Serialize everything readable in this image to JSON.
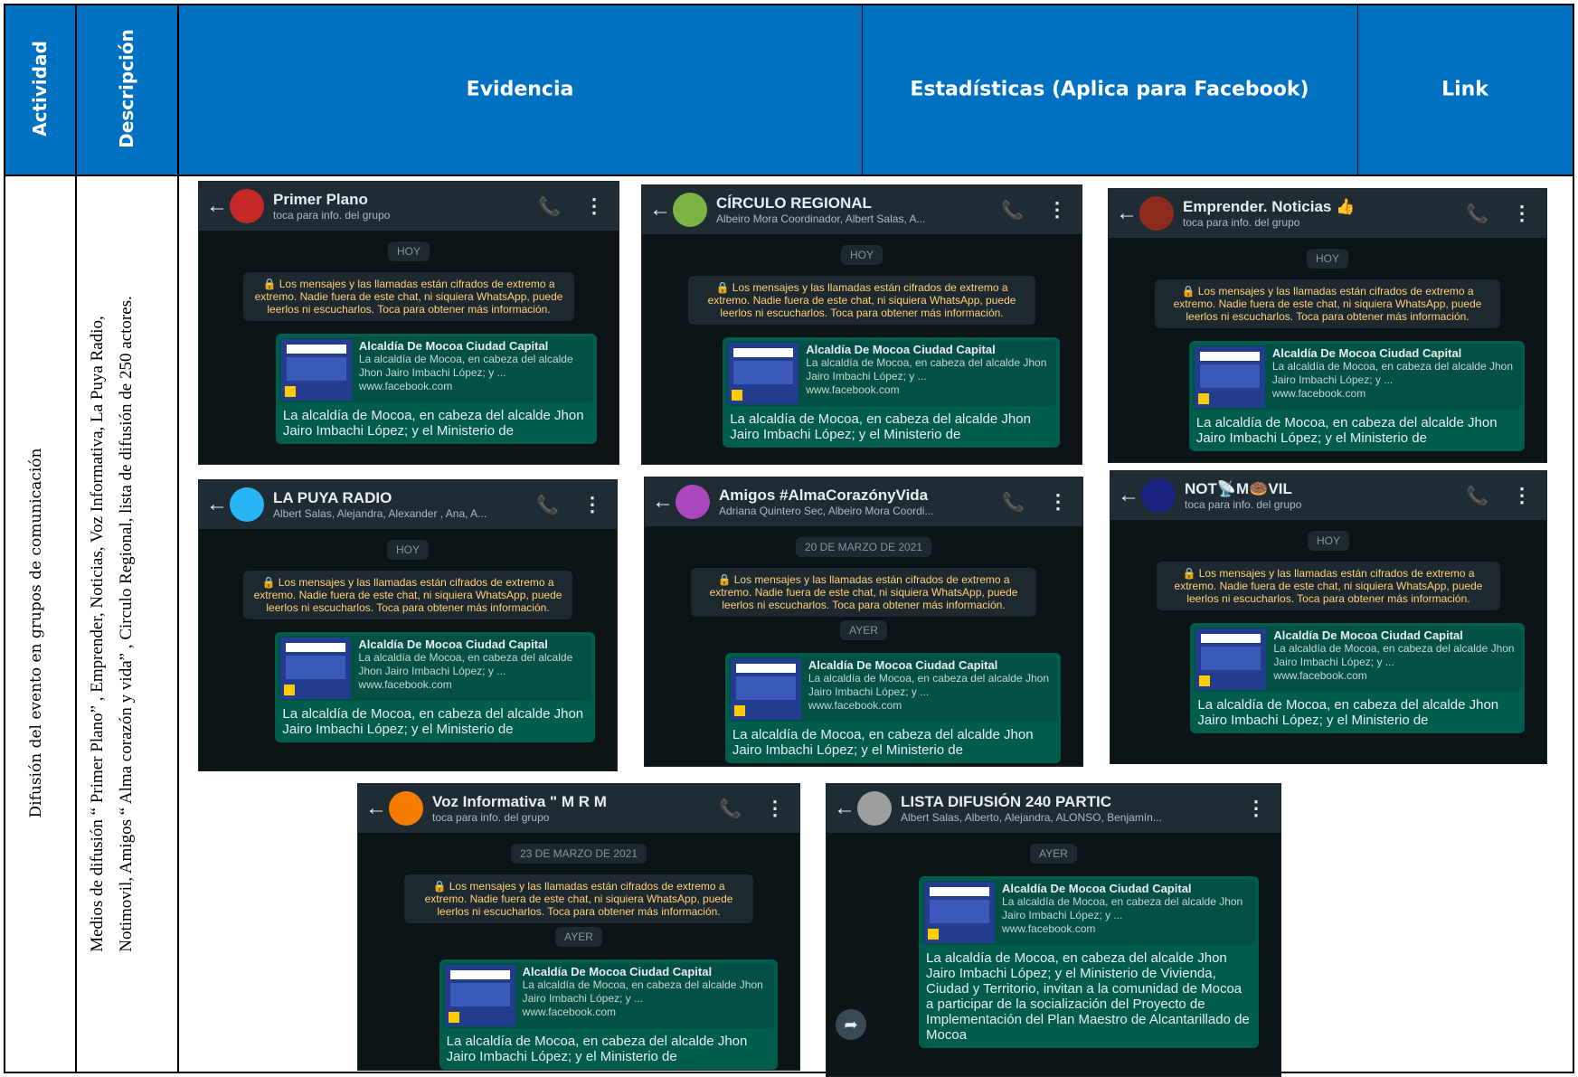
{
  "colors": {
    "header_bg": "#0070C0",
    "header_text": "#FFFFFF"
  },
  "headers": {
    "actividad": "Actividad",
    "descripcion": "Descripción",
    "evidencia": "Evidencia",
    "estadisticas": "Estadísticas (Aplica para Facebook)",
    "link": "Link"
  },
  "row": {
    "actividad": "Difusión del evento en grupos de comunicación",
    "descripcion_line1": "Medios de difusión “ Primer Plano” , Emprender, Noticias, Voz Informativa, La Puya Radio,",
    "descripcion_line2": "Notimovil, Amigos “ Alma corazón y vida” , Circulo Regional, lista de difusión de 250 actores."
  },
  "common": {
    "encryption": "🔒 Los mensajes y las llamadas están cifrados de extremo a extremo. Nadie fuera de este chat, ni siquiera WhatsApp, puede leerlos ni escucharlos. Toca para obtener más información.",
    "preview_title": "Alcaldía De Mocoa Ciudad Capital",
    "preview_desc": "La alcaldía de Mocoa, en cabeza del alcalde Jhon Jairo Imbachi López; y ...",
    "preview_url": "www.facebook.com",
    "message": "La alcaldía de Mocoa, en cabeza del alcalde Jhon Jairo Imbachi López; y el Ministerio de",
    "message_full": "La alcaldía de Mocoa, en cabeza del alcalde Jhon Jairo Imbachi López; y el Ministerio de Vivienda, Ciudad y Territorio, invitan a la comunidad de Mocoa a participar de la socialización del Proyecto de Implementación del Plan Maestro de Alcantarillado de Mocoa"
  },
  "chats": [
    {
      "name": "Primer Plano",
      "sub": "toca para info. del grupo",
      "pill": "HOY",
      "pill2": "",
      "avatar_color": "#c62828",
      "icon": "call-add-icon"
    },
    {
      "name": "CÍRCULO REGIONAL",
      "sub": "Albeiro Mora Coordinador, Albert Salas, A...",
      "pill": "HOY",
      "pill2": "",
      "avatar_color": "#7cb342",
      "icon": "call-add-icon"
    },
    {
      "name": "Emprender. Noticias 👍",
      "sub": "toca para info. del grupo",
      "pill": "HOY",
      "pill2": "",
      "avatar_color": "#8d2b1e",
      "icon": "call-add-icon"
    },
    {
      "name": "LA PUYA RADIO",
      "sub": "Albert Salas, Alejandra, Alexander , Ana, A...",
      "pill": "HOY",
      "pill2": "",
      "avatar_color": "#29b6f6",
      "icon": "call-add-icon"
    },
    {
      "name": "Amigos #AlmaCorazónyVida",
      "sub": "Adriana Quintero Sec, Albeiro Mora Coordi...",
      "pill": "20 DE MARZO DE 2021",
      "pill2": "AYER",
      "avatar_color": "#ab47bc",
      "icon": "call-add-icon"
    },
    {
      "name": "NOT📡M🍩VIL",
      "sub": "toca para info. del grupo",
      "pill": "HOY",
      "pill2": "",
      "avatar_color": "#1a237e",
      "icon": "call-add-icon"
    },
    {
      "name": "Voz Informativa \" M R M",
      "sub": "toca para info. del grupo",
      "pill": "23 DE MARZO DE 2021",
      "pill2": "AYER",
      "avatar_color": "#f57c00",
      "icon": "call-add-icon"
    },
    {
      "name": "LISTA DIFUSIÓN 240 PARTIC",
      "sub": "Albert Salas, Alberto, Alejandra, ALONSO, Benjamín...",
      "pill": "AYER",
      "pill2": "",
      "avatar_color": "#9e9e9e",
      "icon": "broadcast-icon"
    }
  ]
}
